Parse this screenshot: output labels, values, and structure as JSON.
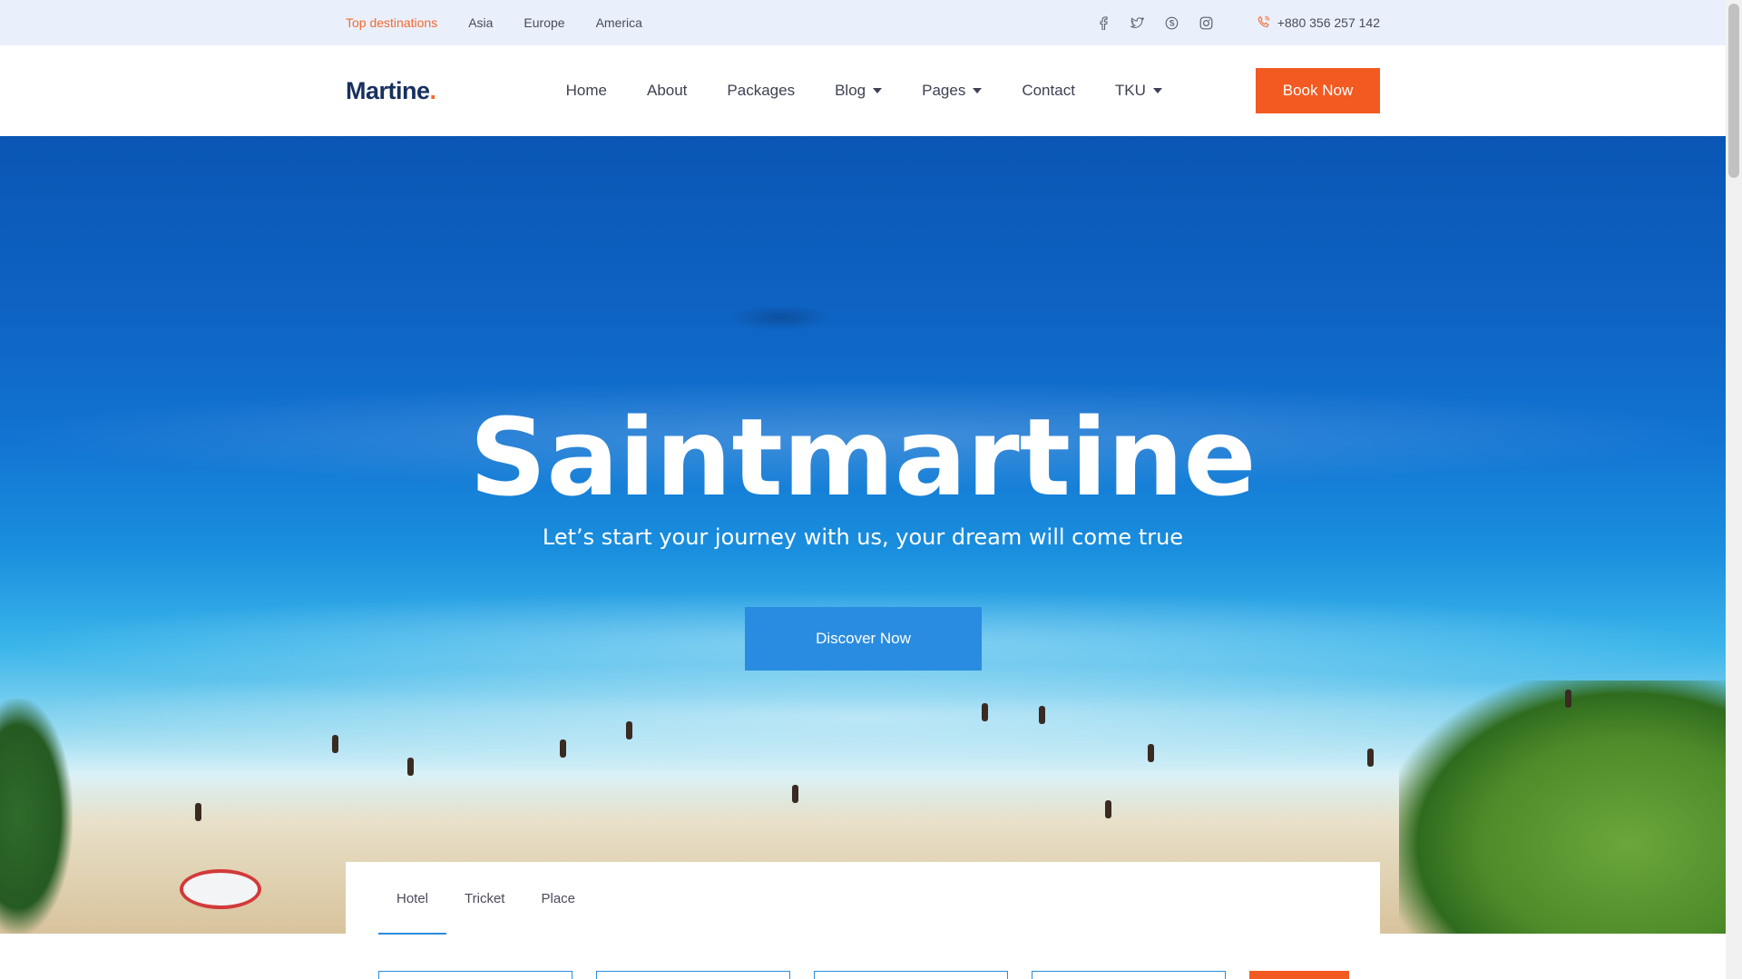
{
  "topbar": {
    "links": [
      "Top destinations",
      "Asia",
      "Europe",
      "America"
    ],
    "active_link": "Top destinations",
    "social_icons": [
      "facebook-icon",
      "twitter-icon",
      "skype-icon",
      "instagram-icon"
    ],
    "phone": "+880 356 257 142"
  },
  "header": {
    "logo": "Martine",
    "logo_dot": ".",
    "nav": [
      {
        "label": "Home",
        "dropdown": false
      },
      {
        "label": "About",
        "dropdown": false
      },
      {
        "label": "Packages",
        "dropdown": false
      },
      {
        "label": "Blog",
        "dropdown": true
      },
      {
        "label": "Pages",
        "dropdown": true
      },
      {
        "label": "Contact",
        "dropdown": false
      },
      {
        "label": "TKU",
        "dropdown": true
      }
    ],
    "book_button": "Book Now"
  },
  "hero": {
    "title": "Saintmartine",
    "subtitle": "Let’s start your journey with us, your dream will come true",
    "cta": "Discover Now"
  },
  "booking": {
    "tabs": [
      "Hotel",
      "Tricket",
      "Place"
    ],
    "active_tab": "Hotel"
  },
  "colors": {
    "accent_orange": "#f35a22",
    "accent_blue": "#2a8ce0",
    "logo_navy": "#17305f",
    "topbar_bg": "#eaf0fb"
  }
}
